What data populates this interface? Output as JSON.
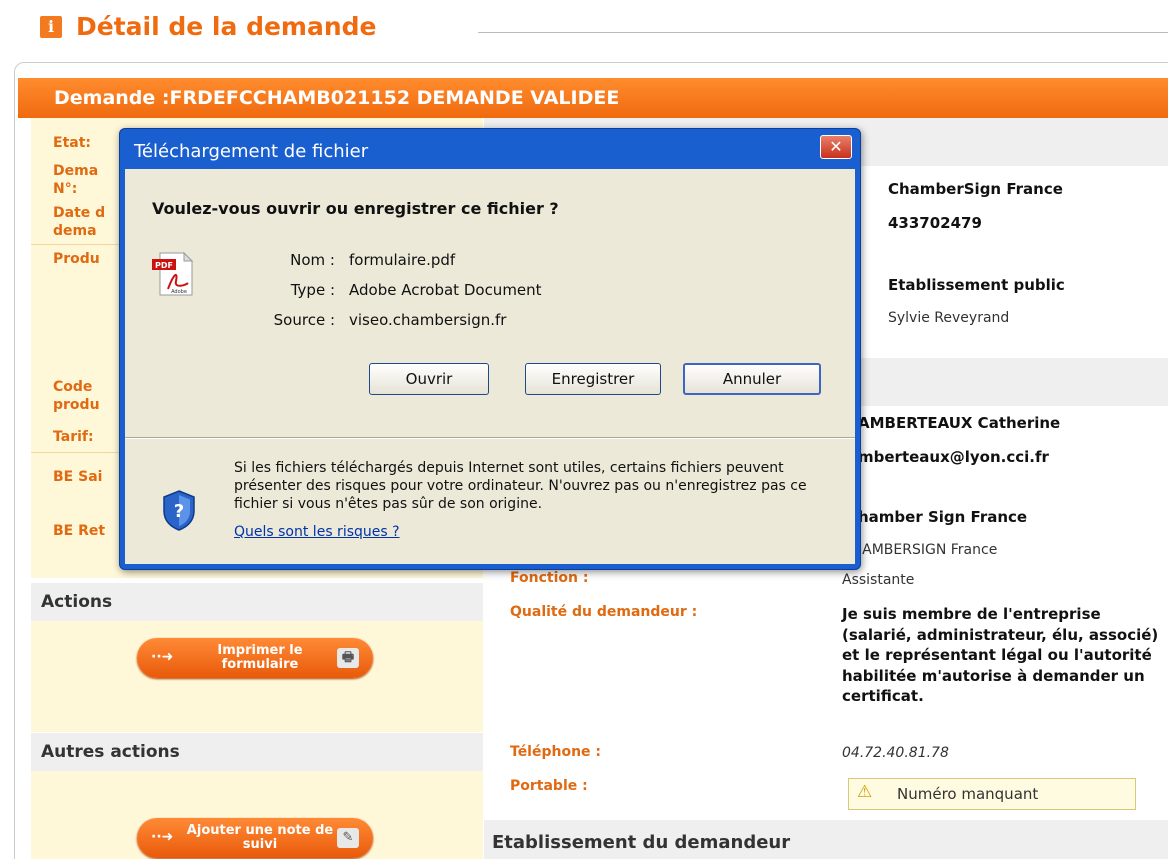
{
  "page": {
    "title": "Détail de la demande",
    "info_icon": "i"
  },
  "request": {
    "header": "Demande  :FRDEFCCHAMB021152 DEMANDE VALIDEE",
    "left_labels": [
      "Etat:",
      "Dema",
      "N°:",
      "Date d",
      "dema",
      "Produ",
      "Code",
      "produ",
      "Tarif:",
      "BE Sai",
      "BE Ret"
    ]
  },
  "details": {
    "company": "ChamberSign France",
    "siren": "433702479",
    "establishment_type": "Etablissement public",
    "person": "Sylvie Reveyrand",
    "applicant_name": "AMBERTEAUX Catherine",
    "applicant_email": "mberteaux@lyon.cci.fr",
    "applicant_company": "hamber Sign France",
    "applicant_company2": "IAMBERSIGN France",
    "function_label": "Fonction :",
    "function_value": "Assistante",
    "quality_label": "Qualité du demandeur :",
    "quality_value": "Je suis membre de l'entreprise (salarié, administrateur, élu, associé) et le représentant légal ou l'autorité habilitée m'autorise à demander un certificat.",
    "phone_label": "Téléphone :",
    "phone_value": "04.72.40.81.78",
    "mobile_label": "Portable :",
    "mobile_warning": "Numéro manquant",
    "establishment_heading": "Etablissement du demandeur"
  },
  "actions": {
    "heading": "Actions",
    "print_button": "Imprimer le formulaire",
    "other_heading": "Autres actions",
    "note_button": "Ajouter une note de suivi"
  },
  "dialog": {
    "title": "Téléchargement de fichier",
    "close": "✕",
    "question": "Voulez-vous ouvrir ou enregistrer ce fichier ?",
    "name_label": "Nom :",
    "name_value": "formulaire.pdf",
    "type_label": "Type :",
    "type_value": "Adobe Acrobat Document",
    "source_label": "Source :",
    "source_value": "viseo.chambersign.fr",
    "open_button": "Ouvrir",
    "save_button": "Enregistrer",
    "cancel_button": "Annuler",
    "warning": "Si les fichiers téléchargés depuis Internet sont utiles, certains fichiers peuvent présenter des risques pour votre ordinateur. N'ouvrez pas ou n'enregistrez pas ce fichier si vous n'êtes pas sûr de son origine.",
    "risk_link": "Quels sont les risques ?",
    "pdf_badge": "PDF",
    "pdf_brand": "Adobe"
  },
  "colors": {
    "accent": "#f06a0f",
    "dialog_frame": "#1a5fd0",
    "dialog_body": "#ece9d8",
    "panel_bg": "#fff8d8"
  }
}
